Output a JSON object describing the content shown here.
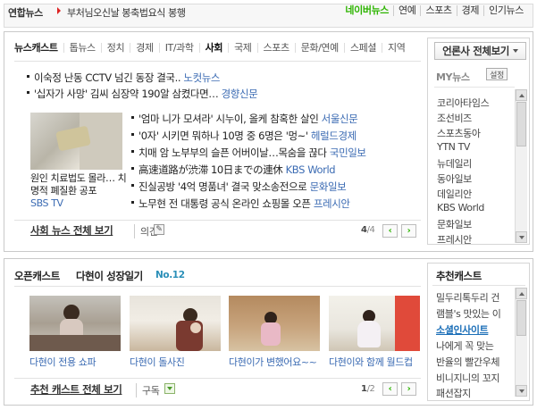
{
  "ticker": {
    "source": "연합뉴스",
    "headline": "부처님오신날 봉축법요식 봉행",
    "links": [
      "네이버뉴스",
      "연예",
      "스포츠",
      "경제",
      "인기뉴스"
    ]
  },
  "newscast": {
    "tabs": [
      "뉴스캐스트",
      "톱뉴스",
      "정치",
      "경제",
      "IT/과학",
      "사회",
      "국제",
      "스포츠",
      "문화/연예",
      "스페셜",
      "지역"
    ],
    "selected_tab": "사회",
    "top_items": [
      {
        "text": "이숙정 난동 CCTV 넘긴 동장 결국..",
        "source": "노컷뉴스"
      },
      {
        "text": "'십자가 사망' 김씨 심장약 190알 삼켰다면…",
        "source": "경향신문"
      }
    ],
    "thumb_caption": "원인 치료법도 몰라… 치명적 폐질환 공포",
    "thumb_source": "SBS TV",
    "items": [
      {
        "text": "'엄마 니가 모셔라' 시누이, 올케 참혹한 살인",
        "source": "서울신문"
      },
      {
        "text": "'0자' 시키면 뭐하나 10명 중 6명은 '멍~'",
        "source": "헤럴드경제"
      },
      {
        "text": "치매 암 노부부의 슬픈 어버이날…목숨을 끊다",
        "source": "국민일보"
      },
      {
        "text": "高速道路が渋滞 10日までの連休",
        "source": "KBS World"
      },
      {
        "text": "진실공방 '4억 명품녀' 결국 맞소송전으로",
        "source": "문화일보"
      },
      {
        "text": "노무현 전 대통령 공식 온라인 쇼핑몰 오픈",
        "source": "프레시안"
      }
    ],
    "more_label": "사회 뉴스 전체 보기",
    "opinion_label": "의견",
    "page": "4",
    "page_total": "/4"
  },
  "press_panel": {
    "header": "언론사 전체보기",
    "my_label": "MY뉴스",
    "settings_label": "설정",
    "press": [
      "코리아타임스",
      "조선비즈",
      "스포츠동아",
      "YTN TV",
      "뉴데일리",
      "동아일보",
      "데일리안",
      "KBS World",
      "문화일보",
      "프레시안"
    ]
  },
  "opencast": {
    "title": "오픈캐스트",
    "cast_name": "다현이 성장일기",
    "cast_no": "No.12",
    "photos": [
      "다현이 전용 쇼파",
      "다현이 돌사진",
      "다현이가 변했어요~~",
      "다현이와 함께 월드컵"
    ],
    "more_label": "추천 캐스트 전체 보기",
    "subscribe_label": "구독",
    "page": "1",
    "page_total": "/2"
  },
  "recommend": {
    "title": "추천캐스트",
    "items": [
      "밀두리톡두리 건",
      "램블's 맛있는 이",
      "소셜인사이트",
      "나에게 꼭 맞는",
      "반율의 빨간우체",
      "비니지니의 꼬지",
      "패션잡지"
    ],
    "highlight_index": 2
  },
  "colors": {
    "accent": "#2db400",
    "link": "#3b6bb3",
    "ticker_arrow": "#dd2222"
  }
}
